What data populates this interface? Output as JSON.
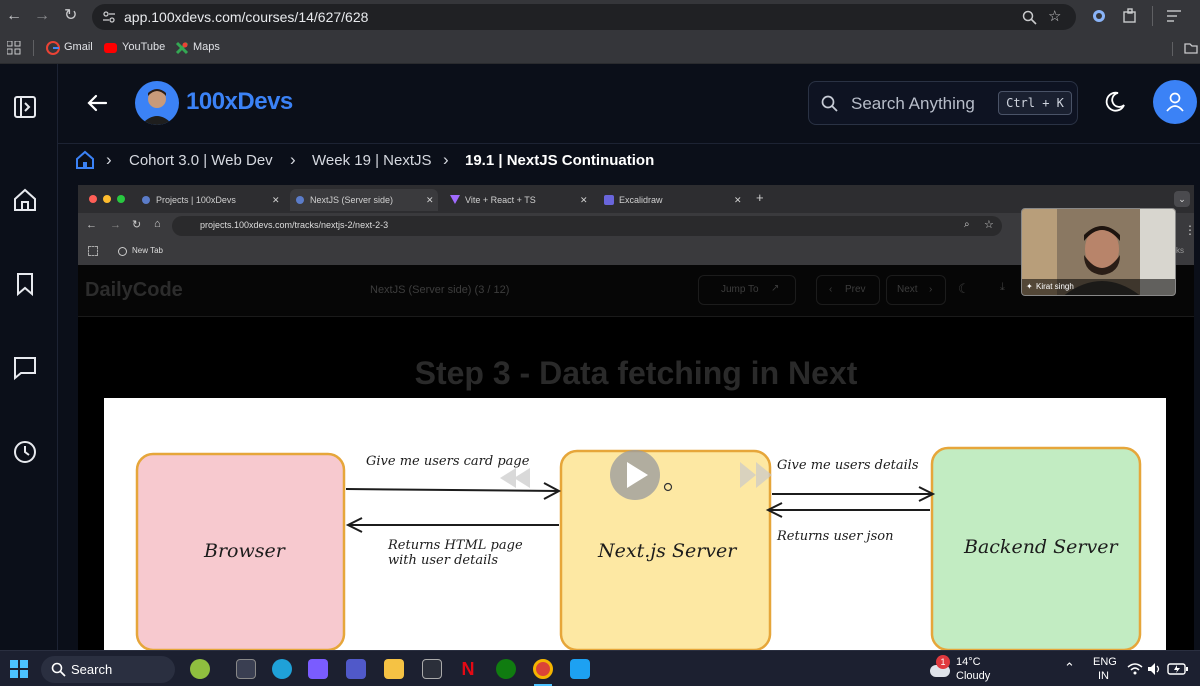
{
  "browser": {
    "url": "app.100xdevs.com/courses/14/627/628",
    "bookmarks": [
      "Gmail",
      "YouTube",
      "Maps"
    ]
  },
  "app": {
    "brand": "100xDevs",
    "search_placeholder": "Search Anything",
    "search_shortcut": "Ctrl + K"
  },
  "breadcrumb": [
    "Cohort 3.0 | Web Dev",
    "Week 19 | NextJS",
    "19.1 | NextJS Continuation"
  ],
  "video": {
    "tabs": [
      "Projects | 100xDevs",
      "NextJS (Server side)",
      "Vite + React + TS",
      "Excalidraw"
    ],
    "url": "projects.100xdevs.com/tracks/nextjs-2/next-2-3",
    "bookmark": "New Tab",
    "site_logo": "DailyCode",
    "lesson": "NextJS (Server side) (3 / 12)",
    "jump_to": "Jump To",
    "prev": "Prev",
    "next": "Next",
    "side_fragment": "ks",
    "step_title": "Step 3 - Data fetching in Next",
    "presenter": "Kirat singh",
    "diagram": {
      "browser": "Browser",
      "server": "Next.js Server",
      "backend": "Backend Server",
      "req1": "Give me users card page",
      "res1_line1": "Returns HTML page",
      "res1_line2": "with user details",
      "req2": "Give me users details",
      "res2": "Returns user json"
    }
  },
  "taskbar": {
    "search": "Search",
    "weather_temp": "14°C",
    "weather_desc": "Cloudy",
    "notif_count": "1",
    "lang_line1": "ENG",
    "lang_line2": "IN"
  },
  "colors": {
    "accent": "#3b82f6",
    "browser_box": "#f7c9cf",
    "server_box": "#fde8a3",
    "backend_box": "#c2ecc2"
  }
}
